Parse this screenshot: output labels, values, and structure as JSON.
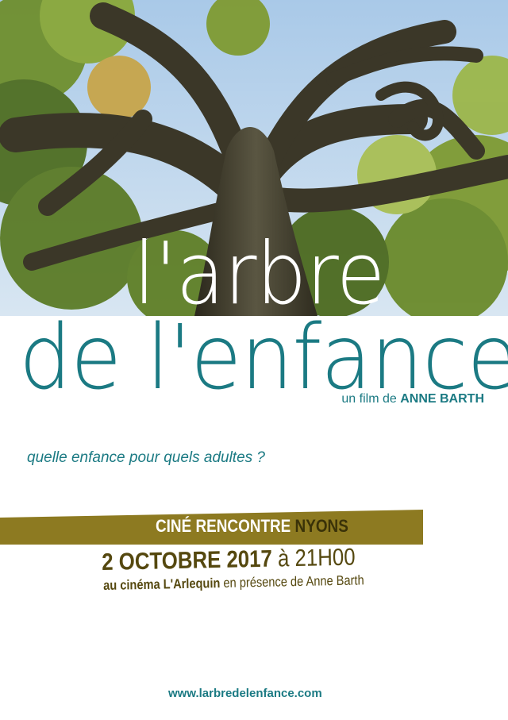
{
  "poster": {
    "title_line1": "l'arbre",
    "title_line2": "de l'enfance",
    "credit_prefix": "un film de ",
    "credit_name": "ANNE BARTH",
    "tagline": "quelle enfance pour quels adultes ?",
    "event_label": "CINÉ RENCONTRE ",
    "event_city": "NYONS",
    "date_bold": "2 OCTOBRE 2017",
    "date_time": " à 21H00",
    "venue_bold": "au cinéma L'Arlequin",
    "venue_rest": " en présence de Anne Barth",
    "website": "www.larbredelenfance.com"
  },
  "colors": {
    "teal": "#1b7a83",
    "olive_band": "#8d7a21",
    "brown_text": "#55480f"
  }
}
